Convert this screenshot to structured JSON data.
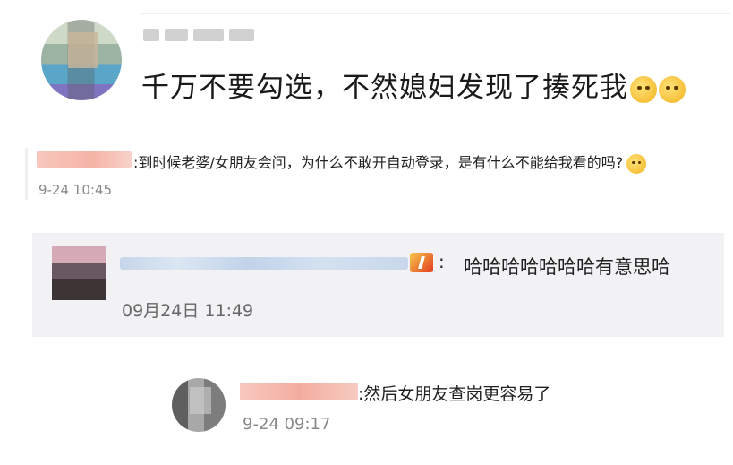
{
  "comment_main": {
    "author": "",
    "text": "千万不要勾选，不然媳妇发现了揍死我",
    "emojis": [
      "doge-emoji",
      "grin-emoji"
    ]
  },
  "reply_1": {
    "text": ":到时候老婆/女朋友会问，为什么不敢开自动登录，是有什么不能给我看的吗?",
    "emoji": "doge-emoji",
    "time": "9-24 10:45"
  },
  "reply_2": {
    "colon": ":",
    "text": "哈哈哈哈哈哈哈有意思哈",
    "time": "09月24日 11:49",
    "badge_icon": "vip-badge-icon"
  },
  "reply_3": {
    "text": ":然后女朋友查岗更容易了",
    "time": "9-24 09:17"
  },
  "colors": {
    "quote_bg": "#f2f2f5",
    "time_text": "#888888",
    "redaction_pink": "#f5b4a6",
    "redaction_blue": "#c6d6ea"
  }
}
